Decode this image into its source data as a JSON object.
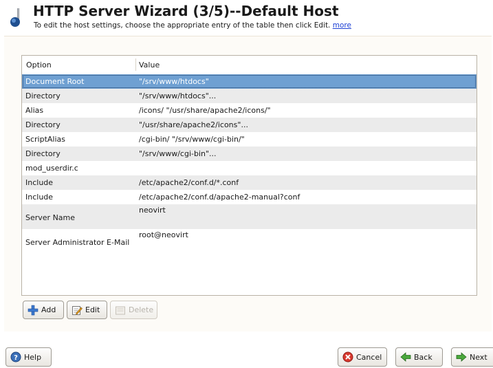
{
  "header": {
    "title": "HTTP Server Wizard (3/5)--Default Host",
    "subtitle": "To edit the host settings, choose the appropriate entry of the table then click Edit.",
    "more_link": "more"
  },
  "table": {
    "columns": [
      "Option",
      "Value"
    ],
    "rows": [
      {
        "option": "Document Root",
        "value": "\"/srv/www/htdocs\""
      },
      {
        "option": "Directory",
        "value": "\"/srv/www/htdocs\"..."
      },
      {
        "option": "Alias",
        "value": "/icons/ \"/usr/share/apache2/icons/\""
      },
      {
        "option": "Directory",
        "value": "\"/usr/share/apache2/icons\"..."
      },
      {
        "option": "ScriptAlias",
        "value": "/cgi-bin/ \"/srv/www/cgi-bin/\""
      },
      {
        "option": "Directory",
        "value": "\"/srv/www/cgi-bin\"..."
      },
      {
        "option": "mod_userdir.c",
        "value": ""
      },
      {
        "option": "Include",
        "value": "/etc/apache2/conf.d/*.conf"
      },
      {
        "option": "Include",
        "value": "/etc/apache2/conf.d/apache2-manual?conf"
      },
      {
        "option": "Server Name",
        "value": "neovirt"
      },
      {
        "option": "Server Administrator E-Mail",
        "value": "root@neovirt"
      }
    ],
    "selected_index": 0
  },
  "table_buttons": {
    "add": {
      "label": "Add",
      "icon": "plus-icon"
    },
    "edit": {
      "label": "Edit",
      "icon": "pencil-icon"
    },
    "delete": {
      "label": "Delete",
      "icon": "delete-icon"
    }
  },
  "footer": {
    "help": {
      "label": "Help",
      "icon": "help-icon"
    },
    "cancel": {
      "label": "Cancel",
      "icon": "cancel-icon"
    },
    "back": {
      "label": "Back",
      "icon": "back-arrow-icon"
    },
    "next": {
      "label": "Next",
      "icon": "next-arrow-icon"
    }
  },
  "colors": {
    "selection": "#6fa0d2",
    "alt_row": "#ebebeb",
    "link": "#1c3fd4"
  }
}
